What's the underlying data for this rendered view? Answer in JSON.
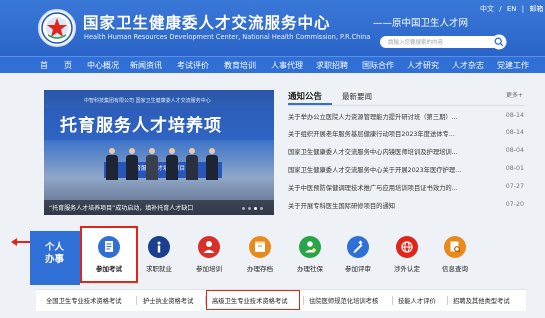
{
  "header": {
    "title_cn": "国家卫生健康委人才交流服务中心",
    "title_en": "Health Human Resources Development Center, National Health Commission, P.R.China",
    "subtitle": "——原中国卫生人才网",
    "top_links": [
      "中文",
      "EN",
      "邮箱"
    ],
    "search_placeholder": "請輸入您要搜索的内容"
  },
  "nav": {
    "items": [
      "首",
      "页",
      "中心概况",
      "新闻资讯",
      "考试评价",
      "教育培训",
      "人事代理",
      "求职招聘",
      "国际合作",
      "人才研究",
      "人才杂志",
      "党建工作"
    ]
  },
  "carousel": {
    "org_text": "中智科技集团有限公司     国家卫生健康委人才交流服务中心",
    "headline": "托育服务人才培养项",
    "ribbon_text": "托育服务人才培养项目",
    "caption": "“托育服务人才培养项目”成功启动，填补托育人才缺口"
  },
  "notices": {
    "tab_active": "通知公告",
    "tab_inactive": "最新要闻",
    "more": "更多+",
    "items": [
      {
        "text": "关于举办公立医院人力资源管理能力提升研讨班（第三期）...",
        "date": "08-14"
      },
      {
        "text": "关于组织开展老年服务基层健康行动项目2023年度送体专...",
        "date": "08-14"
      },
      {
        "text": "国家卫生健康委人才交流服务中心内镜医师培训及护理培训...",
        "date": "08-04"
      },
      {
        "text": "国家卫生健康委人才交流服务中心关于开展2023年医疗护理...",
        "date": "08-01"
      },
      {
        "text": "关于中医预防保健调理技术推广与应用培训项目证书效力的...",
        "date": "07-27"
      },
      {
        "text": "关于开展专科医生国际研修项目的通知",
        "date": "07-20"
      }
    ]
  },
  "services": {
    "personal_label": "个人办事",
    "items": [
      {
        "label": "参加考试",
        "color": "#2f6fd6",
        "icon": "exam-icon"
      },
      {
        "label": "求职就业",
        "color": "#1a3f8f",
        "icon": "info-icon"
      },
      {
        "label": "参加培训",
        "color": "#d9302c",
        "icon": "person-icon"
      },
      {
        "label": "办理存档",
        "color": "#e88a1c",
        "icon": "archive-icon"
      },
      {
        "label": "办理社保",
        "color": "#2aa34a",
        "icon": "person-badge-icon"
      },
      {
        "label": "参加评审",
        "color": "#2f6fd6",
        "icon": "review-icon"
      },
      {
        "label": "涉外认定",
        "color": "#e0251b",
        "icon": "globe-icon"
      },
      {
        "label": "信息查询",
        "color": "#e88a1c",
        "icon": "search-doc-icon"
      }
    ]
  },
  "bottom_tabs": {
    "items": [
      "全国卫生专业技术资格考试",
      "护士执业资格考试",
      "高级卫生专业技术资格考试",
      "住院医师规范化培训考核",
      "技能人才评价",
      "招聘及其他类型考试"
    ]
  },
  "colors": {
    "brand_blue": "#2f6fd6",
    "highlight_red": "#e0251b"
  }
}
